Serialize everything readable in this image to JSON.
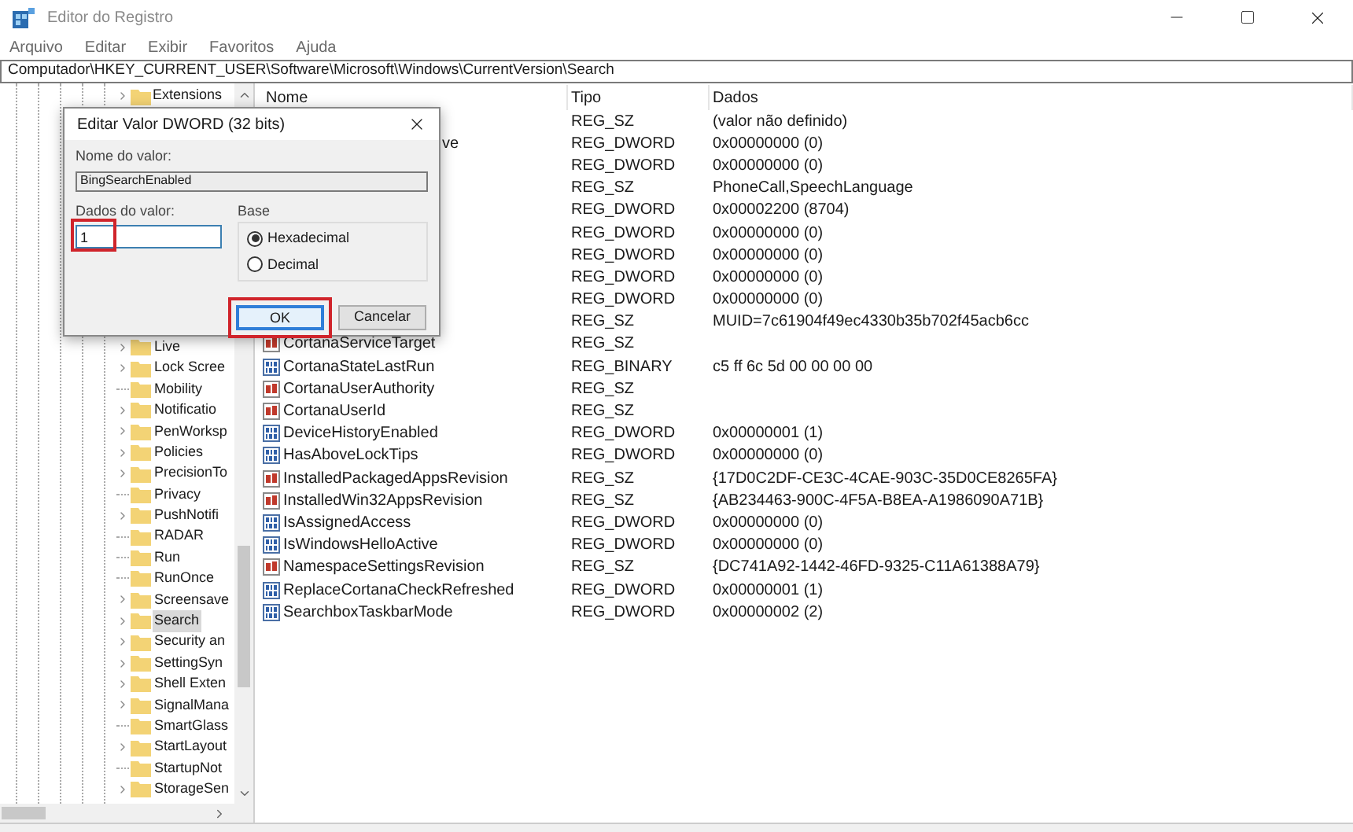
{
  "window": {
    "title": "Editor do Registro"
  },
  "menu": [
    "Arquivo",
    "Editar",
    "Exibir",
    "Favoritos",
    "Ajuda"
  ],
  "address": "Computador\\HKEY_CURRENT_USER\\Software\\Microsoft\\Windows\\CurrentVersion\\Search",
  "tree": {
    "top_item": {
      "label": "Extensions",
      "expandable": true
    },
    "items": [
      {
        "label": "Live",
        "expandable": true,
        "selected": false
      },
      {
        "label": "Lock Scree",
        "expandable": true,
        "selected": false
      },
      {
        "label": "Mobility",
        "expandable": false,
        "selected": false
      },
      {
        "label": "Notificatio",
        "expandable": true,
        "selected": false
      },
      {
        "label": "PenWorksp",
        "expandable": true,
        "selected": false
      },
      {
        "label": "Policies",
        "expandable": true,
        "selected": false
      },
      {
        "label": "PrecisionTo",
        "expandable": true,
        "selected": false
      },
      {
        "label": "Privacy",
        "expandable": false,
        "selected": false
      },
      {
        "label": "PushNotifi",
        "expandable": true,
        "selected": false
      },
      {
        "label": "RADAR",
        "expandable": false,
        "selected": false
      },
      {
        "label": "Run",
        "expandable": false,
        "selected": false
      },
      {
        "label": "RunOnce",
        "expandable": false,
        "selected": false
      },
      {
        "label": "Screensave",
        "expandable": true,
        "selected": false
      },
      {
        "label": "Search",
        "expandable": true,
        "selected": true
      },
      {
        "label": "Security an",
        "expandable": true,
        "selected": false
      },
      {
        "label": "SettingSyn",
        "expandable": true,
        "selected": false
      },
      {
        "label": "Shell Exten",
        "expandable": true,
        "selected": false
      },
      {
        "label": "SignalMana",
        "expandable": true,
        "selected": false
      },
      {
        "label": "SmartGlass",
        "expandable": false,
        "selected": false
      },
      {
        "label": "StartLayout",
        "expandable": true,
        "selected": false
      },
      {
        "label": "StartupNot",
        "expandable": false,
        "selected": false
      },
      {
        "label": "StorageSen",
        "expandable": true,
        "selected": false
      }
    ]
  },
  "list": {
    "columns": [
      "Nome",
      "Tipo",
      "Dados"
    ],
    "rows": [
      {
        "type": "REG_SZ",
        "data": "(valor não definido)"
      },
      {
        "name_fragment": "ve",
        "type": "REG_DWORD",
        "data": "0x00000000 (0)"
      },
      {
        "type": "REG_DWORD",
        "data": "0x00000000 (0)"
      },
      {
        "type": "REG_SZ",
        "data": "PhoneCall,SpeechLanguage"
      },
      {
        "type": "REG_DWORD",
        "data": "0x00002200 (8704)"
      },
      {
        "type": "REG_DWORD",
        "data": "0x00000000 (0)"
      },
      {
        "type": "REG_DWORD",
        "data": "0x00000000 (0)"
      },
      {
        "type": "REG_DWORD",
        "data": "0x00000000 (0)"
      },
      {
        "type": "REG_DWORD",
        "data": "0x00000000 (0)"
      },
      {
        "type": "REG_SZ",
        "data": "MUID=7c61904f49ec4330b35b702f45acb6cc"
      },
      {
        "kind": "string",
        "name": "CortanaServiceTarget",
        "type": "REG_SZ"
      },
      {
        "kind": "binary",
        "name": "CortanaStateLastRun",
        "type": "REG_BINARY",
        "data": "c5 ff 6c 5d 00 00 00 00"
      },
      {
        "kind": "string",
        "name": "CortanaUserAuthority",
        "type": "REG_SZ"
      },
      {
        "kind": "string",
        "name": "CortanaUserId",
        "type": "REG_SZ"
      },
      {
        "kind": "binary",
        "name": "DeviceHistoryEnabled",
        "type": "REG_DWORD",
        "data": "0x00000001 (1)"
      },
      {
        "kind": "binary",
        "name": "HasAboveLockTips",
        "type": "REG_DWORD",
        "data": "0x00000000 (0)"
      },
      {
        "kind": "string",
        "name": "InstalledPackagedAppsRevision",
        "type": "REG_SZ",
        "data": "{17D0C2DF-CE3C-4CAE-903C-35D0CE8265FA}"
      },
      {
        "kind": "string",
        "name": "InstalledWin32AppsRevision",
        "type": "REG_SZ",
        "data": "{AB234463-900C-4F5A-B8EA-A1986090A71B}"
      },
      {
        "kind": "binary",
        "name": "IsAssignedAccess",
        "type": "REG_DWORD",
        "data": "0x00000000 (0)"
      },
      {
        "kind": "binary",
        "name": "IsWindowsHelloActive",
        "type": "REG_DWORD",
        "data": "0x00000000 (0)"
      },
      {
        "kind": "string",
        "name": "NamespaceSettingsRevision",
        "type": "REG_SZ",
        "data": "{DC741A92-1442-46FD-9325-C11A61388A79}"
      },
      {
        "kind": "binary",
        "name": "ReplaceCortanaCheckRefreshed",
        "type": "REG_DWORD",
        "data": "0x00000001 (1)"
      },
      {
        "kind": "binary",
        "name": "SearchboxTaskbarMode",
        "type": "REG_DWORD",
        "data": "0x00000002 (2)"
      }
    ]
  },
  "dialog": {
    "title": "Editar Valor DWORD (32 bits)",
    "name_label": "Nome do valor:",
    "name_value": "BingSearchEnabled",
    "data_label": "Dados do valor:",
    "data_value": "1",
    "data_highlighted": true,
    "base": {
      "label": "Base",
      "options": [
        {
          "label": "Hexadecimal",
          "selected": true
        },
        {
          "label": "Decimal",
          "selected": false
        }
      ]
    },
    "buttons": [
      {
        "label": "OK",
        "default": true,
        "highlighted": true
      },
      {
        "label": "Cancelar",
        "default": false,
        "highlighted": false
      }
    ]
  }
}
